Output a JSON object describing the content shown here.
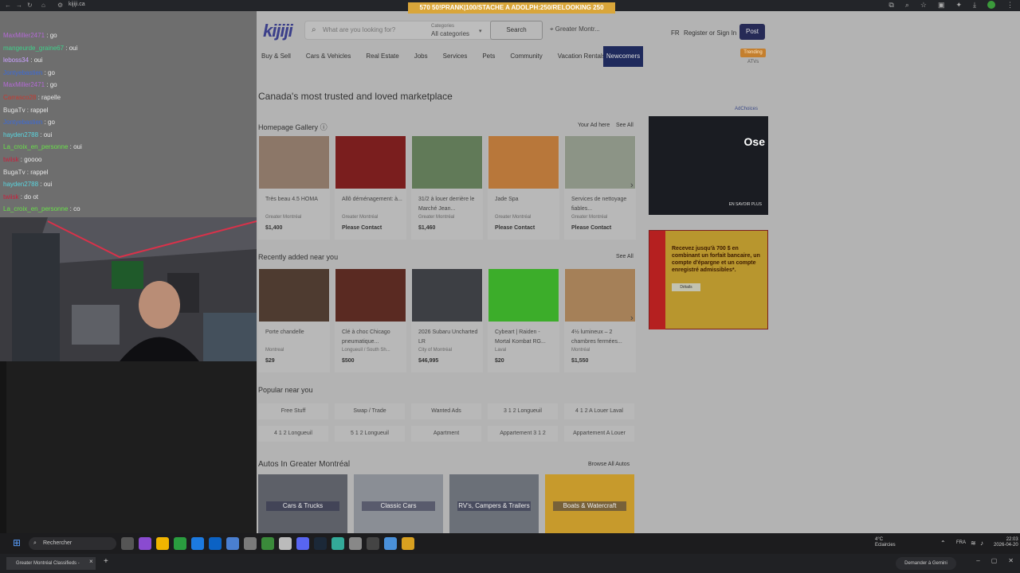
{
  "browser": {
    "url": "kijiji.ca",
    "banner": "570        50!PRANK|100/STACHE A ADOLPH:250/RELOOKING 250"
  },
  "kijiji": {
    "logo": "kijiji",
    "search_placeholder": "What are you looking for?",
    "category_label": "Categories",
    "category_value": "All categories",
    "search_button": "Search",
    "location": "Greater Montr...",
    "lang": "FR",
    "register": "Register or Sign In",
    "post": "Post",
    "nav": [
      "Buy & Sell",
      "Cars & Vehicles",
      "Real Estate",
      "Jobs",
      "Services",
      "Pets",
      "Community",
      "Vacation Rentals"
    ],
    "newcomers": "Newcomers",
    "trending": "Trending",
    "trending_sub": "ATVs",
    "tagline": "Canada's most trusted and loved marketplace",
    "gallery_title": "Homepage Gallery",
    "gallery_your_ad": "Your Ad here",
    "see_all": "See All",
    "gallery": [
      {
        "title": "Très beau 4.5 HOMA",
        "loc": "Greater Montréal",
        "price": "$1,400"
      },
      {
        "title": "Allô déménagement: à...",
        "loc": "Greater Montréal",
        "price": "Please Contact"
      },
      {
        "title": "31/2 à louer derrière le Marché Jean...",
        "loc": "Greater Montréal",
        "price": "$1,460"
      },
      {
        "title": "Jade Spa",
        "loc": "Greater Montréal",
        "price": "Please Contact"
      },
      {
        "title": "Services de nettoyage fiables...",
        "loc": "Greater Montréal",
        "price": "Please Contact"
      }
    ],
    "recent_title": "Recently added near you",
    "recent": [
      {
        "title": "Porte chandelle",
        "loc": "Montreal",
        "price": "$29"
      },
      {
        "title": "Clé à choc Chicago pneumatique...",
        "loc": "Longueuil / South Sh...",
        "price": "$500"
      },
      {
        "title": "2026 Subaru Uncharted LR",
        "loc": "City of Montréal",
        "price": "$46,995"
      },
      {
        "title": "Cybeart | Raiden - Mortal Kombat RG...",
        "loc": "Laval",
        "price": "$20"
      },
      {
        "title": "4½ lumineux – 2 chambres fermées...",
        "loc": "Montréal",
        "price": "$1,550"
      }
    ],
    "popular_title": "Popular near you",
    "popular": [
      "Free Stuff",
      "Swap / Trade",
      "Wanted Ads",
      "3 1 2 Longueuil",
      "4 1 2 A Louer Laval",
      "4 1 2 Longueuil",
      "5 1 2 Longueuil",
      "Apartment",
      "Appartement 3 1 2",
      "Appartement A Louer"
    ],
    "autos_title": "Autos In Greater Montréal",
    "autos_link": "Browse All Autos",
    "autos": [
      "Cars & Trucks",
      "Classic Cars",
      "RV's, Campers & Trailers",
      "Boats & Watercraft"
    ],
    "adchoices": "AdChoices",
    "ad1_title": "Ose",
    "ad1_cta": "EN SAVOIR PLUS",
    "ad2_text": "Recevez jusqu'à 700 $ en combinant un forfait bancaire, un compte d'épargne et un compte enregistré admissibles*.",
    "ad2_btn": "Détails"
  },
  "chat": [
    {
      "user": "MaxMiller2471",
      "text": "go",
      "color": "#b46ad6"
    },
    {
      "user": "mangeurde_graine67",
      "text": "oui",
      "color": "#3fd08a"
    },
    {
      "user": "leboss34",
      "text": "oui",
      "color": "#c9a0ff"
    },
    {
      "user": "Jontyebastien",
      "text": "go",
      "color": "#3c6ad6"
    },
    {
      "user": "MaxMiller2471",
      "text": "go",
      "color": "#b46ad6"
    },
    {
      "user": "Carrasco28",
      "text": "rapelle",
      "color": "#c8382e"
    },
    {
      "user": "BugaTv",
      "text": "rappel",
      "color": "#e0e0e0"
    },
    {
      "user": "Jontyebastien",
      "text": "go",
      "color": "#3c6ad6"
    },
    {
      "user": "hayden2788",
      "text": "oui",
      "color": "#59d6e0"
    },
    {
      "user": "La_croix_en_personne",
      "text": "oui",
      "color": "#69e04a"
    },
    {
      "user": "twiisk",
      "text": "goooo",
      "color": "#c8203c"
    },
    {
      "user": "BugaTv",
      "text": "rappel",
      "color": "#e0e0e0"
    },
    {
      "user": "hayden2788",
      "text": "oui",
      "color": "#59d6e0"
    },
    {
      "user": "twiisk",
      "text": "do ot",
      "color": "#c8203c"
    },
    {
      "user": "La_croix_en_personne",
      "text": "co",
      "color": "#69e04a"
    }
  ],
  "taskbar": {
    "search": "Rechercher",
    "temp": "4°C",
    "weather": "Eclaircies",
    "lang": "FRA",
    "time": "22:03",
    "date": "2026-04-20"
  },
  "tabs": {
    "tab1": "Greater Montréal Classifieds -",
    "gemini": "Demander à Gemini"
  }
}
